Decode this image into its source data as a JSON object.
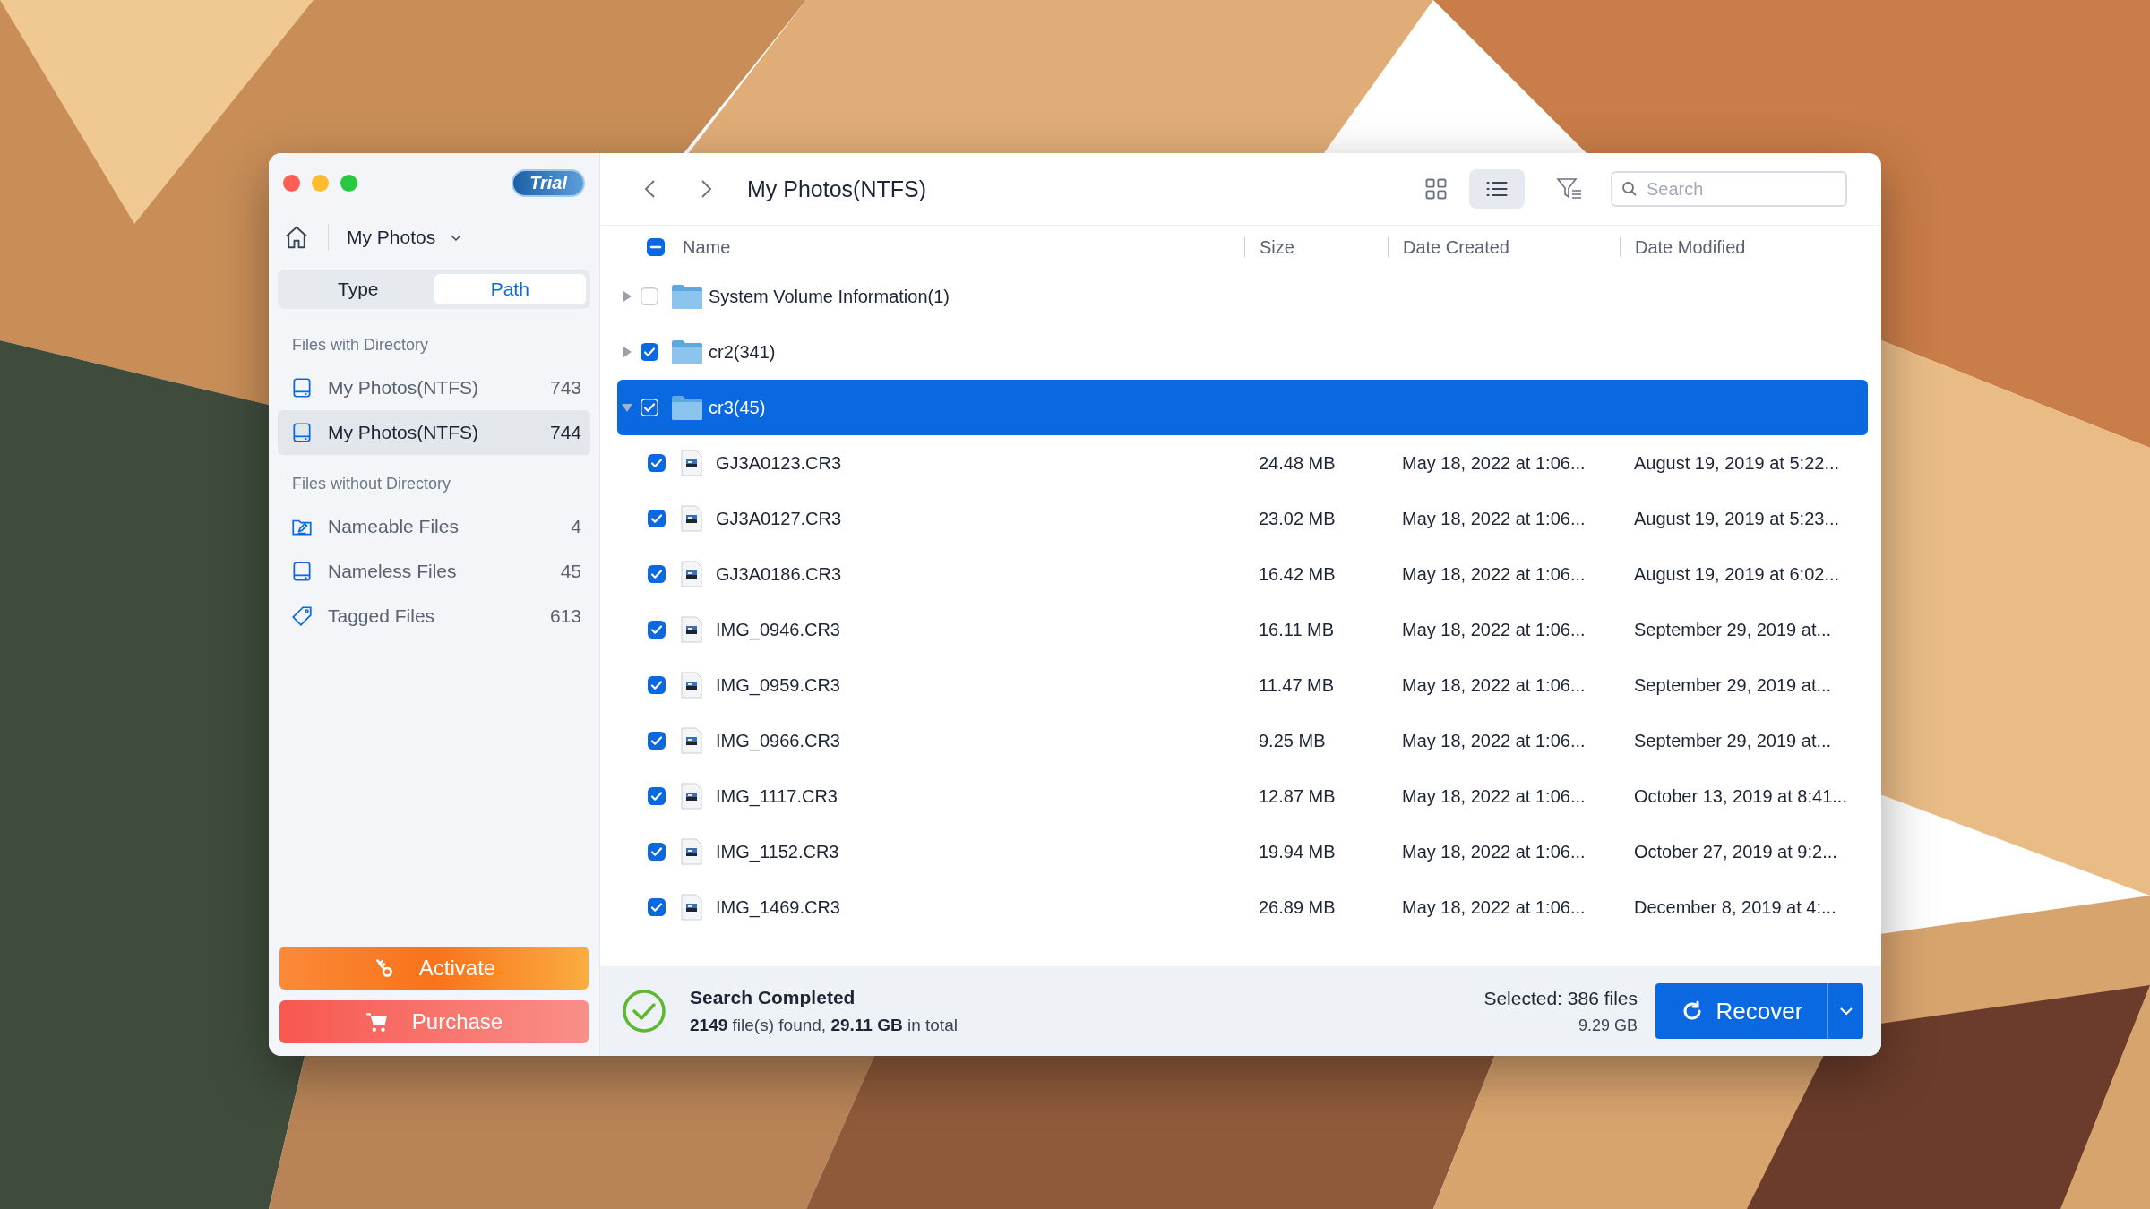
{
  "sidebar": {
    "badge": "Trial",
    "location": "My Photos",
    "tabs": [
      {
        "label": "Type",
        "selected": false
      },
      {
        "label": "Path",
        "selected": true
      }
    ],
    "sections": [
      {
        "heading": "Files with Directory",
        "items": [
          {
            "kind": "drive",
            "label": "My Photos(NTFS)",
            "count": "743",
            "selected": false
          },
          {
            "kind": "drive",
            "label": "My Photos(NTFS)",
            "count": "744",
            "selected": true
          }
        ]
      },
      {
        "heading": "Files without Directory",
        "items": [
          {
            "kind": "nameable",
            "label": "Nameable Files",
            "count": "4",
            "selected": false
          },
          {
            "kind": "drive",
            "label": "Nameless Files",
            "count": "45",
            "selected": false
          },
          {
            "kind": "tag",
            "label": "Tagged Files",
            "count": "613",
            "selected": false
          }
        ]
      }
    ],
    "buttons": [
      {
        "kind": "activate",
        "label": "Activate"
      },
      {
        "kind": "purchase",
        "label": "Purchase"
      }
    ]
  },
  "toolbar": {
    "title": "My Photos(NTFS)",
    "views": [
      {
        "kind": "grid",
        "selected": false
      },
      {
        "kind": "list",
        "selected": true
      }
    ],
    "search": {
      "placeholder": "Search"
    }
  },
  "table": {
    "select_all_partial": true,
    "columns": [
      "Name",
      "Size",
      "Date Created",
      "Date Modified"
    ],
    "rows": [
      {
        "kind": "folder",
        "name": "System Volume Information(1)",
        "checked": false,
        "expanded": false,
        "selected": false
      },
      {
        "kind": "folder",
        "name": "cr2(341)",
        "checked": true,
        "expanded": false,
        "selected": false
      },
      {
        "kind": "folder",
        "name": "cr3(45)",
        "checked": true,
        "expanded": true,
        "selected": true,
        "children": [
          {
            "kind": "file",
            "name": "GJ3A0123.CR3",
            "size": "24.48 MB",
            "created": "May 18, 2022 at 1:06...",
            "modified": "August 19, 2019 at 5:22...",
            "checked": true,
            "selected": false
          },
          {
            "kind": "file",
            "name": "GJ3A0127.CR3",
            "size": "23.02 MB",
            "created": "May 18, 2022 at 1:06...",
            "modified": "August 19, 2019 at 5:23...",
            "checked": true,
            "selected": false
          },
          {
            "kind": "file",
            "name": "GJ3A0186.CR3",
            "size": "16.42 MB",
            "created": "May 18, 2022 at 1:06...",
            "modified": "August 19, 2019 at 6:02...",
            "checked": true,
            "selected": false
          },
          {
            "kind": "file",
            "name": "IMG_0946.CR3",
            "size": "16.11 MB",
            "created": "May 18, 2022 at 1:06...",
            "modified": "September 29, 2019 at...",
            "checked": true,
            "selected": false
          },
          {
            "kind": "file",
            "name": "IMG_0959.CR3",
            "size": "11.47 MB",
            "created": "May 18, 2022 at 1:06...",
            "modified": "September 29, 2019 at...",
            "checked": true,
            "selected": false
          },
          {
            "kind": "file",
            "name": "IMG_0966.CR3",
            "size": "9.25 MB",
            "created": "May 18, 2022 at 1:06...",
            "modified": "September 29, 2019 at...",
            "checked": true,
            "selected": false
          },
          {
            "kind": "file",
            "name": "IMG_1117.CR3",
            "size": "12.87 MB",
            "created": "May 18, 2022 at 1:06...",
            "modified": "October 13, 2019 at 8:41...",
            "checked": true,
            "selected": false
          },
          {
            "kind": "file",
            "name": "IMG_1152.CR3",
            "size": "19.94 MB",
            "created": "May 18, 2022 at 1:06...",
            "modified": "October 27, 2019 at 9:2...",
            "checked": true,
            "selected": false
          },
          {
            "kind": "file",
            "name": "IMG_1469.CR3",
            "size": "26.89 MB",
            "created": "May 18, 2022 at 1:06...",
            "modified": "December 8, 2019 at 4:...",
            "checked": true,
            "selected": false
          }
        ]
      }
    ]
  },
  "status": {
    "title": "Search Completed",
    "summary": "**2149** file(s) found, **29.11 GB** in total",
    "selected": "Selected: 386 files",
    "size": "9.29 GB",
    "action": "Recover"
  }
}
